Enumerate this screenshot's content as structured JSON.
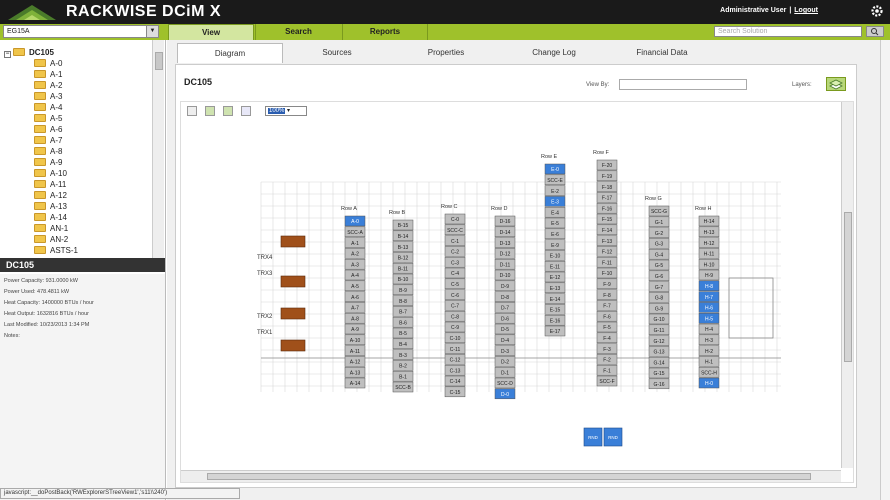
{
  "header": {
    "app_title": "RACKWISE DCiM X",
    "user": "Administrative User",
    "separator": "|",
    "logout": "Logout",
    "icons": {
      "logo": "pyramid-logo-icon",
      "settings": "gear-icon"
    }
  },
  "subbar": {
    "site_select_value": "EG15A",
    "tabs": [
      "View",
      "Search",
      "Reports"
    ],
    "search_placeholder": "Search Solution"
  },
  "tree": {
    "root": "DC105",
    "items": [
      "A-0",
      "A-1",
      "A-2",
      "A-3",
      "A-4",
      "A-5",
      "A-6",
      "A-7",
      "A-8",
      "A-9",
      "A-10",
      "A-11",
      "A-12",
      "A-13",
      "A-14",
      "AN-1",
      "AN-2",
      "ASTS-1"
    ]
  },
  "properties": {
    "heading": "DC105",
    "lines": [
      "Power Capacity:    931.0000  kW",
      "Power Used:    478.4811  kW",
      "Heat Capacity:    1400000  BTUs / hour",
      "Heat Output:    1632816  BTUs / hour",
      "Last Modified:    10/23/2013 1:34 PM",
      "Notes:"
    ]
  },
  "content_tabs": [
    "Diagram",
    "Sources",
    "Properties",
    "Change Log",
    "Financial Data"
  ],
  "diagram": {
    "title": "DC105",
    "view_by_label": "View By:",
    "layers_label": "Layers:",
    "zoom_value": "100%",
    "trx_labels": [
      "TRX4",
      "TRX3",
      "TRX2",
      "TRX1"
    ],
    "rows": [
      {
        "label": "Row A",
        "racks": [
          "A-0",
          "SCC-A",
          "A-1",
          "A-2",
          "A-3",
          "A-4",
          "A-5",
          "A-6",
          "A-7",
          "A-8",
          "A-9",
          "A-10",
          "A-11",
          "A-12",
          "A-13",
          "A-14"
        ],
        "highlight": [
          0
        ]
      },
      {
        "label": "Row B",
        "racks": [
          "B-15",
          "B-14",
          "B-13",
          "B-12",
          "B-11",
          "B-10",
          "B-9",
          "B-8",
          "B-7",
          "B-6",
          "B-5",
          "B-4",
          "B-3",
          "B-2",
          "B-1",
          "SCC-B"
        ],
        "highlight": []
      },
      {
        "label": "Row C",
        "racks": [
          "C-0",
          "SCC-C",
          "C-1",
          "C-2",
          "C-3",
          "C-4",
          "C-5",
          "C-6",
          "C-7",
          "C-8",
          "C-9",
          "C-10",
          "C-11",
          "C-12",
          "C-13",
          "C-14",
          "C-15"
        ],
        "highlight": []
      },
      {
        "label": "Row D",
        "racks": [
          "D-16",
          "D-14",
          "D-13",
          "D-12",
          "D-11",
          "D-10",
          "D-9",
          "D-8",
          "D-7",
          "D-6",
          "D-5",
          "D-4",
          "D-3",
          "D-2",
          "D-1",
          "SCC-D",
          "D-0"
        ],
        "highlight": [
          16
        ]
      },
      {
        "label": "Row E",
        "racks": [
          "E-0",
          "SCC-E",
          "E-2",
          "E-3",
          "E-4",
          "E-5",
          "E-6",
          "E-9",
          "E-10",
          "E-11",
          "E-12",
          "E-13",
          "E-14",
          "E-15",
          "E-16",
          "E-17"
        ],
        "highlight": [
          0,
          3
        ]
      },
      {
        "label": "Row F",
        "racks": [
          "F-20",
          "F-19",
          "F-18",
          "F-17",
          "F-16",
          "F-15",
          "F-14",
          "F-13",
          "F-12",
          "F-11",
          "F-10",
          "F-9",
          "F-8",
          "F-7",
          "F-6",
          "F-5",
          "F-4",
          "F-3",
          "F-2",
          "F-1",
          "SCC-F"
        ],
        "highlight": []
      },
      {
        "label": "Row G",
        "racks": [
          "SCC-G",
          "G-1",
          "G-2",
          "G-3",
          "G-4",
          "G-5",
          "G-6",
          "G-7",
          "G-8",
          "G-9",
          "G-10",
          "G-11",
          "G-12",
          "G-13",
          "G-14",
          "G-15",
          "G-16"
        ],
        "highlight": []
      },
      {
        "label": "Row H",
        "racks": [
          "H-14",
          "H-13",
          "H-12",
          "H-11",
          "H-10",
          "H-9",
          "H-8",
          "H-7",
          "H-6",
          "H-5",
          "H-4",
          "H-3",
          "H-2",
          "H-1",
          "SCC-H",
          "H-0"
        ],
        "highlight": [
          6,
          7,
          8,
          9,
          15
        ]
      }
    ],
    "rnd_labels": [
      "RND",
      "RND"
    ]
  },
  "status_bar": "javascript:__doPostBack('RWExplorerSTreeView1','s11\\\\240')",
  "colors": {
    "accent": "#9fc12b",
    "header": "#1a1a1a",
    "rack": "#bfbfbf",
    "rack_selected": "#3a7fd8",
    "trx": "#a0501a"
  }
}
